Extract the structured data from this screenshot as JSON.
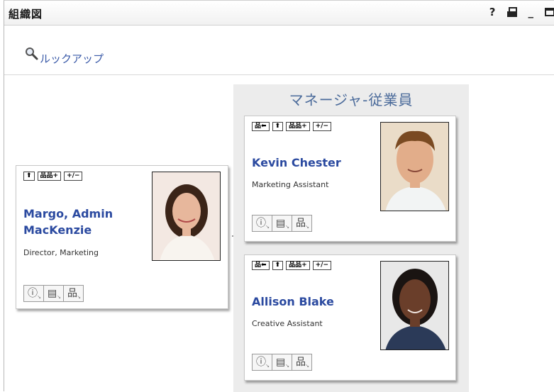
{
  "window": {
    "title": "組織図",
    "controls": {
      "help": "?",
      "print": "print-icon",
      "minimize": "_",
      "maximize": "maximize-icon"
    }
  },
  "lookup": {
    "label": "ルックアップ",
    "icon": "magnifier-icon"
  },
  "manager_panel": {
    "title": "マネージャ-従業員"
  },
  "toolbar_labels": {
    "show_manager": "品⬅",
    "up": "⬆",
    "expand": "品品+",
    "toggle": "+/−"
  },
  "actions": {
    "info": "info-icon",
    "email": "email-icon",
    "org": "org-chart-icon"
  },
  "people": {
    "root": {
      "name": "Margo, Admin MacKenzie",
      "title": "Director, Marketing"
    },
    "employees": [
      {
        "name": "Kevin Chester",
        "title": "Marketing Assistant"
      },
      {
        "name": "Allison Blake",
        "title": "Creative Assistant"
      }
    ]
  },
  "colors": {
    "link": "#2b4aa0",
    "panel_title": "#4a6a9a",
    "panel_bg": "#ececec"
  }
}
